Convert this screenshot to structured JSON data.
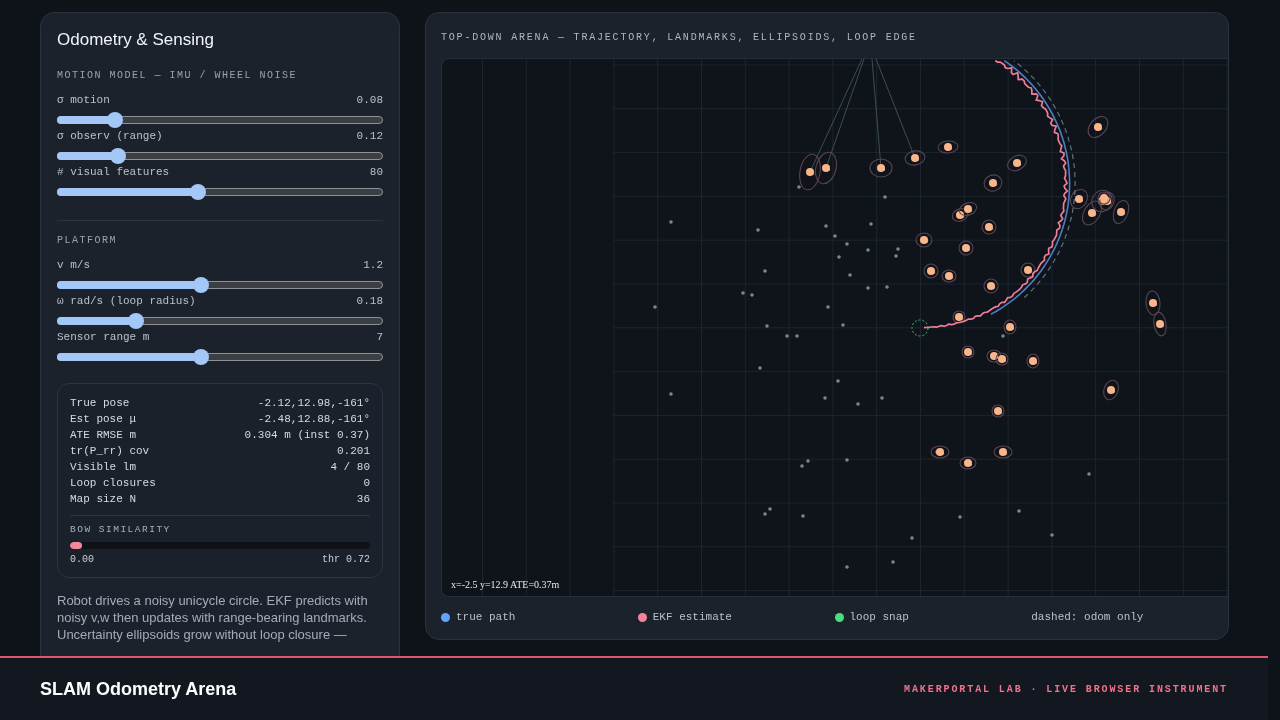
{
  "sidebar": {
    "title": "Odometry & Sensing",
    "sections": [
      {
        "heading": "MOTION MODEL — IMU / WHEEL NOISE",
        "sliders": [
          {
            "label": "σ motion",
            "value": "0.08",
            "level": 0.16
          },
          {
            "label": "σ observ (range)",
            "value": "0.12",
            "level": 0.17
          },
          {
            "label": "# visual features",
            "value": "80",
            "level": 0.43
          }
        ]
      },
      {
        "heading": "PLATFORM",
        "sliders": [
          {
            "label": "v m/s",
            "value": "1.2",
            "level": 0.44
          },
          {
            "label": "ω rad/s (loop radius)",
            "value": "0.18",
            "level": 0.23
          },
          {
            "label": "Sensor range m",
            "value": "7",
            "level": 0.44
          }
        ]
      }
    ],
    "stats": [
      {
        "label": "True pose",
        "value": "-2.12,12.98,-161°"
      },
      {
        "label": "Est pose μ",
        "value": "-2.48,12.88,-161°"
      },
      {
        "label": "ATE RMSE m",
        "value": "0.304 m (inst 0.37)"
      },
      {
        "label": "tr(P_rr) cov",
        "value": "0.201"
      },
      {
        "label": "Visible lm",
        "value": "4 / 80"
      },
      {
        "label": "Loop closures",
        "value": "0"
      },
      {
        "label": "Map size N",
        "value": "36"
      }
    ],
    "similarity": {
      "heading": "BOW SIMILARITY",
      "level": 0.04,
      "reading": "0.00",
      "threshold": "thr 0.72"
    },
    "description": "Robot drives a noisy unicycle circle. EKF predicts with noisy v,w then updates with range-bearing landmarks. Uncertainty ellipsoids grow without loop closure —"
  },
  "arena": {
    "title": "TOP-DOWN ARENA — TRAJECTORY, LANDMARKS, ELLIPSOIDS, LOOP EDGE",
    "readout": "x=-2.5 y=12.9 ATE=0.37m",
    "legend": [
      {
        "kind": "swatch",
        "label": "true path",
        "color": "#60a5fa"
      },
      {
        "kind": "swatch",
        "label": "EKF estimate",
        "color": "#f7839b"
      },
      {
        "kind": "swatch",
        "label": "loop snap",
        "color": "#4ade80"
      },
      {
        "kind": "note",
        "label": "dashed: odom only"
      }
    ]
  },
  "footer": {
    "title": "SLAM Odometry Arena",
    "tagline": "MAKERPORTAL LAB · LIVE BROWSER INSTRUMENT"
  }
}
